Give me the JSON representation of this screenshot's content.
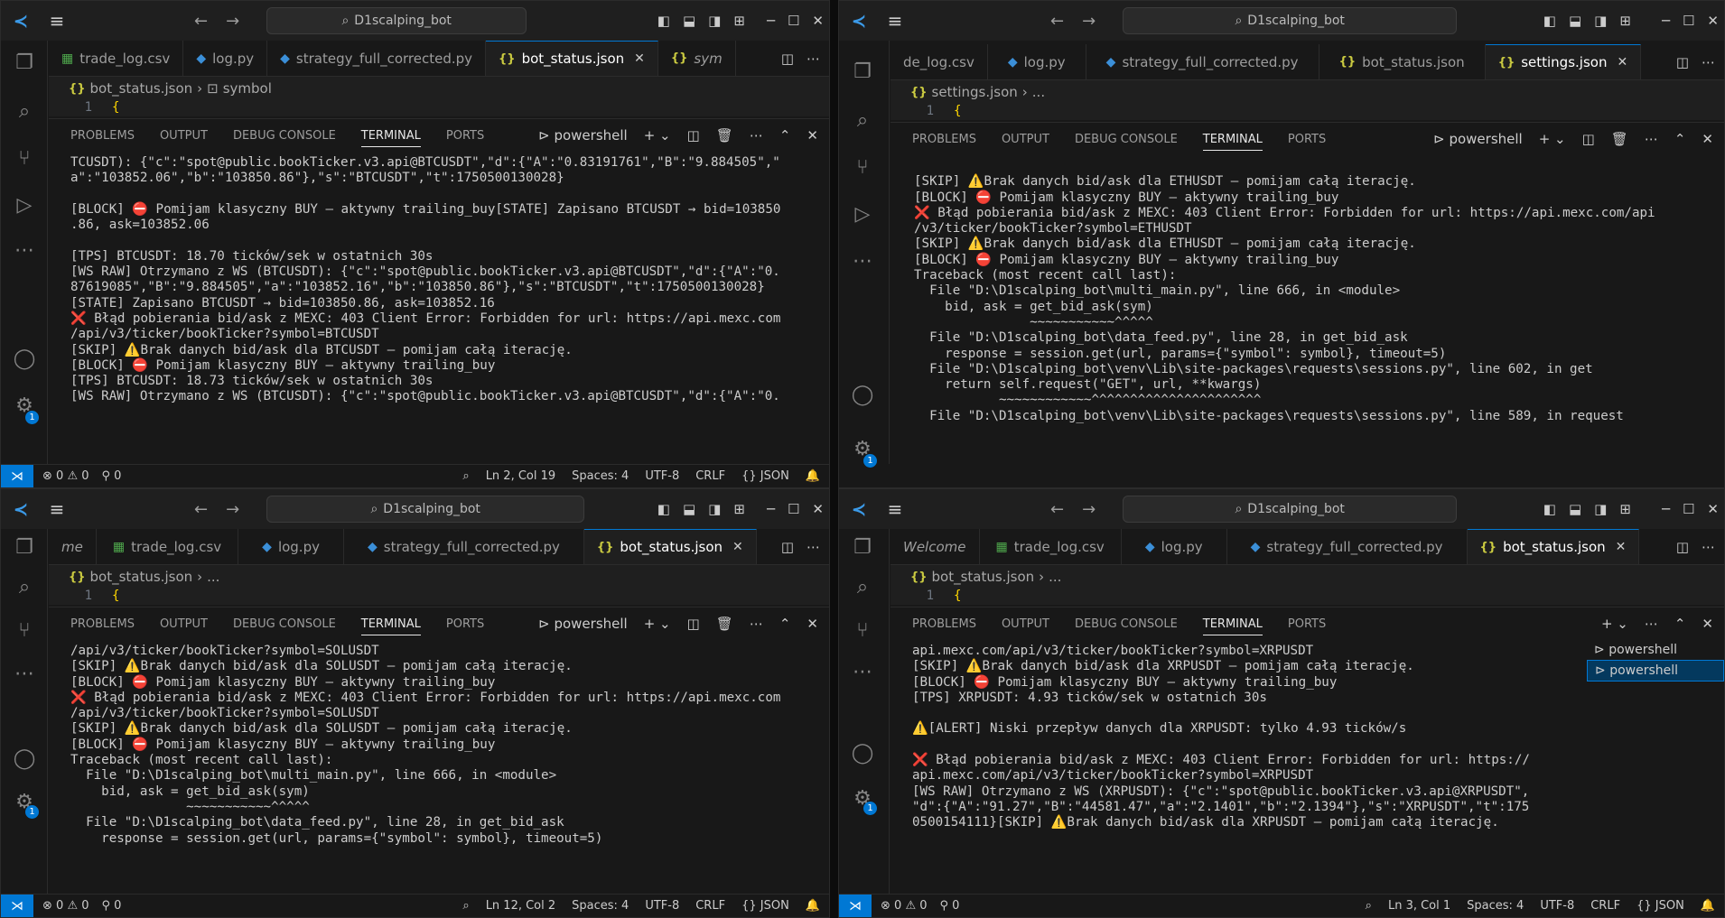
{
  "common": {
    "search": "D1scalping_bot",
    "errors": "0",
    "warnings": "0",
    "ports": "0",
    "encoding": "UTF-8",
    "eol": "CRLF",
    "language": "JSON",
    "spaces": "Spaces: 4",
    "panel_tabs": [
      "PROBLEMS",
      "OUTPUT",
      "DEBUG CONSOLE",
      "TERMINAL",
      "PORTS"
    ],
    "shell": "powershell",
    "brace": "{",
    "line_no": "1"
  },
  "w1": {
    "tabs": [
      {
        "label": "trade_log.csv",
        "icon": "csv-icon"
      },
      {
        "label": "log.py",
        "icon": "python-icon"
      },
      {
        "label": "strategy_full_corrected.py",
        "icon": "python-icon"
      },
      {
        "label": "bot_status.json",
        "icon": "json-icon",
        "active": true
      },
      {
        "label": "sym",
        "icon": "json-icon"
      }
    ],
    "crumb_file": "bot_status.json",
    "crumb_item": "symbol",
    "cursor": "Ln 2, Col 19",
    "terminal": [
      "TCUSDT): {\"c\":\"spot@public.bookTicker.v3.api@BTCUSDT\",\"d\":{\"A\":\"0.83191761\",\"B\":\"9.884505\",\"",
      "a\":\"103852.06\",\"b\":\"103850.86\"},\"s\":\"BTCUSDT\",\"t\":1750500130028}",
      "",
      "[BLOCK] ⛔ Pomijam klasyczny BUY – aktywny trailing_buy[STATE] Zapisano BTCUSDT → bid=103850",
      ".86, ask=103852.06",
      "",
      "[TPS] BTCUSDT: 18.70 ticków/sek w ostatnich 30s",
      "[WS RAW] Otrzymano z WS (BTCUSDT): {\"c\":\"spot@public.bookTicker.v3.api@BTCUSDT\",\"d\":{\"A\":\"0.",
      "87619085\",\"B\":\"9.884505\",\"a\":\"103852.16\",\"b\":\"103850.86\"},\"s\":\"BTCUSDT\",\"t\":1750500130028}",
      "[STATE] Zapisano BTCUSDT → bid=103850.86, ask=103852.16",
      "❌ Błąd pobierania bid/ask z MEXC: 403 Client Error: Forbidden for url: https://api.mexc.com",
      "/api/v3/ticker/bookTicker?symbol=BTCUSDT",
      "[SKIP] ⚠️Brak danych bid/ask dla BTCUSDT – pomijam całą iterację.",
      "[BLOCK] ⛔ Pomijam klasyczny BUY – aktywny trailing_buy",
      "[TPS] BTCUSDT: 18.73 ticków/sek w ostatnich 30s",
      "[WS RAW] Otrzymano z WS (BTCUSDT): {\"c\":\"spot@public.bookTicker.v3.api@BTCUSDT\",\"d\":{\"A\":\"0."
    ]
  },
  "w2": {
    "tabs": [
      {
        "label": "de_log.csv",
        "icon": "csv-icon"
      },
      {
        "label": "log.py",
        "icon": "python-icon"
      },
      {
        "label": "strategy_full_corrected.py",
        "icon": "python-icon"
      },
      {
        "label": "bot_status.json",
        "icon": "json-icon"
      },
      {
        "label": "settings.json",
        "icon": "json-icon",
        "active": true
      }
    ],
    "crumb_file": "settings.json",
    "crumb_item": "...",
    "terminal": [
      "",
      "[SKIP] ⚠️Brak danych bid/ask dla ETHUSDT – pomijam całą iterację.",
      "[BLOCK] ⛔ Pomijam klasyczny BUY – aktywny trailing_buy",
      "❌ Błąd pobierania bid/ask z MEXC: 403 Client Error: Forbidden for url: https://api.mexc.com/api",
      "/v3/ticker/bookTicker?symbol=ETHUSDT",
      "[SKIP] ⚠️Brak danych bid/ask dla ETHUSDT – pomijam całą iterację.",
      "[BLOCK] ⛔ Pomijam klasyczny BUY – aktywny trailing_buy",
      "Traceback (most recent call last):",
      "  File \"D:\\D1scalping_bot\\multi_main.py\", line 666, in <module>",
      "    bid, ask = get_bid_ask(sym)",
      "               ~~~~~~~~~~~^^^^^",
      "  File \"D:\\D1scalping_bot\\data_feed.py\", line 28, in get_bid_ask",
      "    response = session.get(url, params={\"symbol\": symbol}, timeout=5)",
      "  File \"D:\\D1scalping_bot\\venv\\Lib\\site-packages\\requests\\sessions.py\", line 602, in get",
      "    return self.request(\"GET\", url, **kwargs)",
      "           ~~~~~~~~~~~~^^^^^^^^^^^^^^^^^^^^^^",
      "  File \"D:\\D1scalping_bot\\venv\\Lib\\site-packages\\requests\\sessions.py\", line 589, in request"
    ]
  },
  "w3": {
    "tabs": [
      {
        "label": "me",
        "icon": ""
      },
      {
        "label": "trade_log.csv",
        "icon": "csv-icon"
      },
      {
        "label": "log.py",
        "icon": "python-icon"
      },
      {
        "label": "strategy_full_corrected.py",
        "icon": "python-icon"
      },
      {
        "label": "bot_status.json",
        "icon": "json-icon",
        "active": true
      }
    ],
    "crumb_file": "bot_status.json",
    "crumb_item": "...",
    "cursor": "Ln 12, Col 2",
    "terminal": [
      "/api/v3/ticker/bookTicker?symbol=SOLUSDT",
      "[SKIP] ⚠️Brak danych bid/ask dla SOLUSDT – pomijam całą iterację.",
      "[BLOCK] ⛔ Pomijam klasyczny BUY – aktywny trailing_buy",
      "❌ Błąd pobierania bid/ask z MEXC: 403 Client Error: Forbidden for url: https://api.mexc.com",
      "/api/v3/ticker/bookTicker?symbol=SOLUSDT",
      "[SKIP] ⚠️Brak danych bid/ask dla SOLUSDT – pomijam całą iterację.",
      "[BLOCK] ⛔ Pomijam klasyczny BUY – aktywny trailing_buy",
      "Traceback (most recent call last):",
      "  File \"D:\\D1scalping_bot\\multi_main.py\", line 666, in <module>",
      "    bid, ask = get_bid_ask(sym)",
      "               ~~~~~~~~~~~^^^^^",
      "  File \"D:\\D1scalping_bot\\data_feed.py\", line 28, in get_bid_ask",
      "    response = session.get(url, params={\"symbol\": symbol}, timeout=5)"
    ]
  },
  "w4": {
    "tabs": [
      {
        "label": "Welcome",
        "icon": ""
      },
      {
        "label": "trade_log.csv",
        "icon": "csv-icon"
      },
      {
        "label": "log.py",
        "icon": "python-icon"
      },
      {
        "label": "strategy_full_corrected.py",
        "icon": "python-icon"
      },
      {
        "label": "bot_status.json",
        "icon": "json-icon",
        "active": true
      }
    ],
    "crumb_file": "bot_status.json",
    "crumb_item": "...",
    "cursor": "Ln 3, Col 1",
    "terminal_list": [
      "powershell",
      "powershell"
    ],
    "terminal": [
      "api.mexc.com/api/v3/ticker/bookTicker?symbol=XRPUSDT",
      "[SKIP] ⚠️Brak danych bid/ask dla XRPUSDT – pomijam całą iterację.",
      "[BLOCK] ⛔ Pomijam klasyczny BUY – aktywny trailing_buy",
      "[TPS] XRPUSDT: 4.93 ticków/sek w ostatnich 30s",
      "",
      "⚠️[ALERT] Niski przepływ danych dla XRPUSDT: tylko 4.93 ticków/s",
      "",
      "❌ Błąd pobierania bid/ask z MEXC: 403 Client Error: Forbidden for url: https://",
      "api.mexc.com/api/v3/ticker/bookTicker?symbol=XRPUSDT",
      "[WS RAW] Otrzymano z WS (XRPUSDT): {\"c\":\"spot@public.bookTicker.v3.api@XRPUSDT\",",
      "\"d\":{\"A\":\"91.27\",\"B\":\"44581.47\",\"a\":\"2.1401\",\"b\":\"2.1394\"},\"s\":\"XRPUSDT\",\"t\":175",
      "0500154111}[SKIP] ⚠️Brak danych bid/ask dla XRPUSDT – pomijam całą iterację."
    ]
  }
}
